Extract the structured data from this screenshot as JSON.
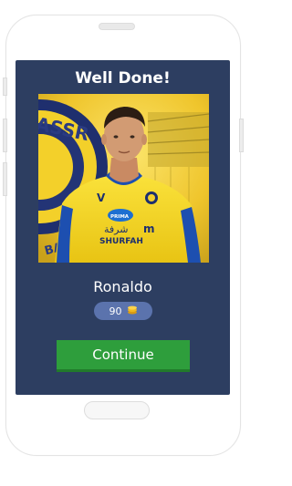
{
  "dialog": {
    "title": "Well Done!",
    "player_name": "Ronaldo",
    "coins": "90",
    "continue_label": "Continue"
  },
  "photo": {
    "crest_text": "ASSR",
    "crest_text_2": "BALL",
    "sponsor_arabic": "شرفة",
    "sponsor": "SHURFAH",
    "logo_badge": "PRIMA",
    "kit_letter": "V"
  },
  "colors": {
    "panel": "#2d3e61",
    "button": "#2e9e3c",
    "coin_badge": "#5b73ad",
    "jersey": "#f7d21e"
  },
  "icons": [
    "coin-stack-icon"
  ]
}
